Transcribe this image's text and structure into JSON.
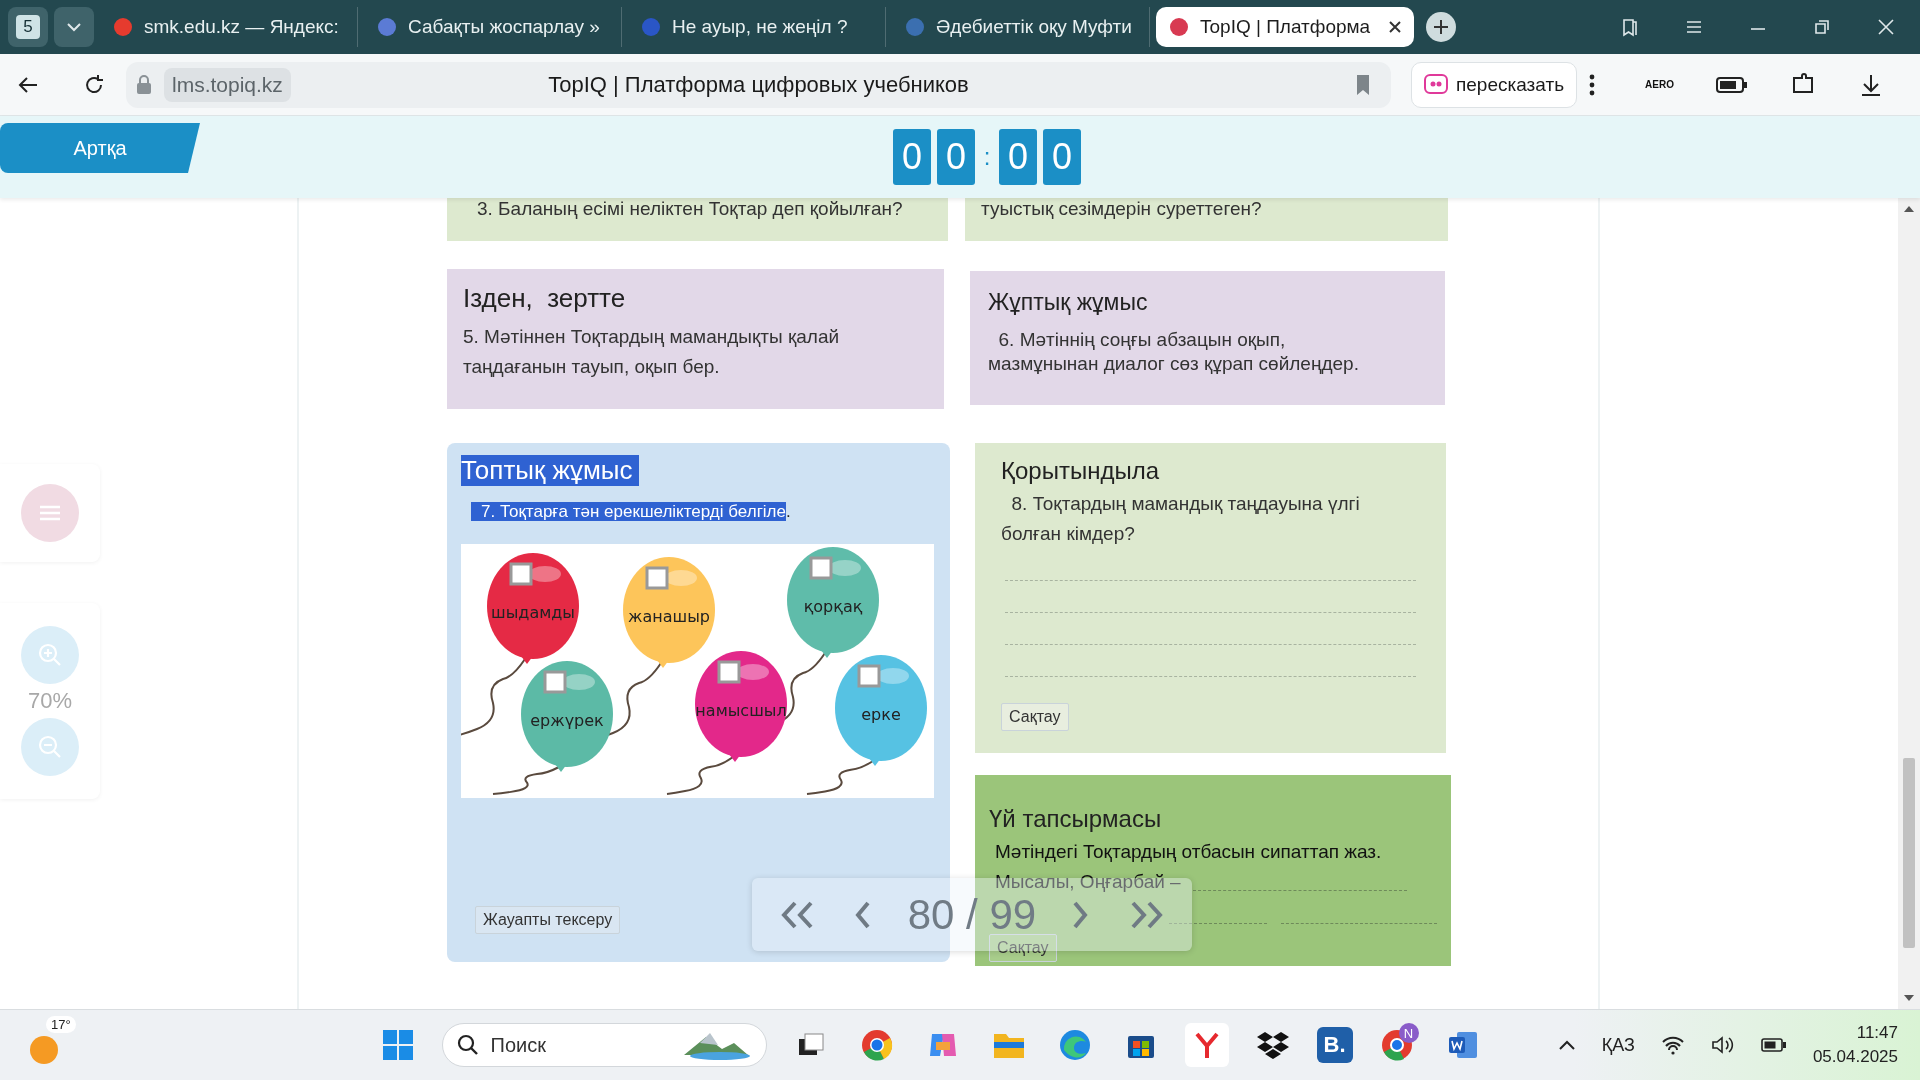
{
  "browser_tabs": {
    "counter": "5",
    "tabs": [
      {
        "title": "smk.edu.kz — Яндекс:",
        "selected": false
      },
      {
        "title": "Сабақты жоспарлау »",
        "selected": false
      },
      {
        "title": "Не ауыр, не жеңіл ?",
        "selected": false
      },
      {
        "title": "Әдебиеттік оқу Муфти",
        "selected": false
      },
      {
        "title": "TopIQ | Платформа",
        "selected": true
      }
    ]
  },
  "address_bar": {
    "url": "lms.topiq.kz",
    "page_title": "TopIQ | Платформа цифровых учебников",
    "retell_button": "пересказать",
    "extension_label": "AERO"
  },
  "header": {
    "back_button": "Артқа",
    "timer": [
      "0",
      "0",
      ":",
      "0",
      "0"
    ]
  },
  "sidebar": {
    "zoom": "70%"
  },
  "cards_top": [
    {
      "text": "3. Баланың есімі неліктен Тоқтар деп қойылған?"
    },
    {
      "text": "туыстық сезімдерін суреттеген?"
    }
  ],
  "cards_middle": [
    {
      "title": "Ізден,  зертте",
      "lines": [
        "5. Мәтіннен Тоқтардың мамандықты қалай",
        "таңдағанын тауып, оқып бер."
      ]
    },
    {
      "title": "Жұптық жұмыс",
      "lines": [
        "  6. Мәтіннің соңғы абзацын оқып,",
        "мазмұнынан диалог сөз құрап сөйлеңдер."
      ]
    }
  ],
  "group_work": {
    "title": "Топтық жұмыс",
    "title_highlighted": true,
    "task_highlighted": "7. Тоқтарға тән ерекшеліктерді белгіле",
    "task_rest": ".",
    "balloons": [
      {
        "label": "шыдамды",
        "color": "#e52a45",
        "checked": false
      },
      {
        "label": "жанашыр",
        "color": "#fdc55a",
        "checked": false
      },
      {
        "label": "қорқақ",
        "color": "#5fbcaa",
        "checked": false
      },
      {
        "label": "ержүрек",
        "color": "#5cbaa6",
        "checked": false
      },
      {
        "label": "намысшыл",
        "color": "#e3288a",
        "checked": false
      },
      {
        "label": "ерке",
        "color": "#56c2e3",
        "checked": false
      }
    ],
    "check_button": "Жауапты тексеру"
  },
  "summary": {
    "title": "Қорытындыла",
    "lines": [
      "  8. Тоқтардың мамандық таңдауына үлгі",
      "болған кімдер?"
    ],
    "save_button": "Сақтау"
  },
  "homework": {
    "title": "Үй тапсырмасы",
    "lines": [
      "Мәтіндегі Тоқтардың отбасын сипаттап жаз.",
      "Мысалы, Оңғарбай –"
    ],
    "save_button": "Сақтау"
  },
  "pagination": {
    "page": "80 / 99"
  },
  "taskbar": {
    "weather": "17°",
    "search_placeholder": "Поиск",
    "app_letter": "B.",
    "profile_badge": "N",
    "language": "ҚАЗ",
    "time": "11:47",
    "date": "05.04.2025"
  }
}
